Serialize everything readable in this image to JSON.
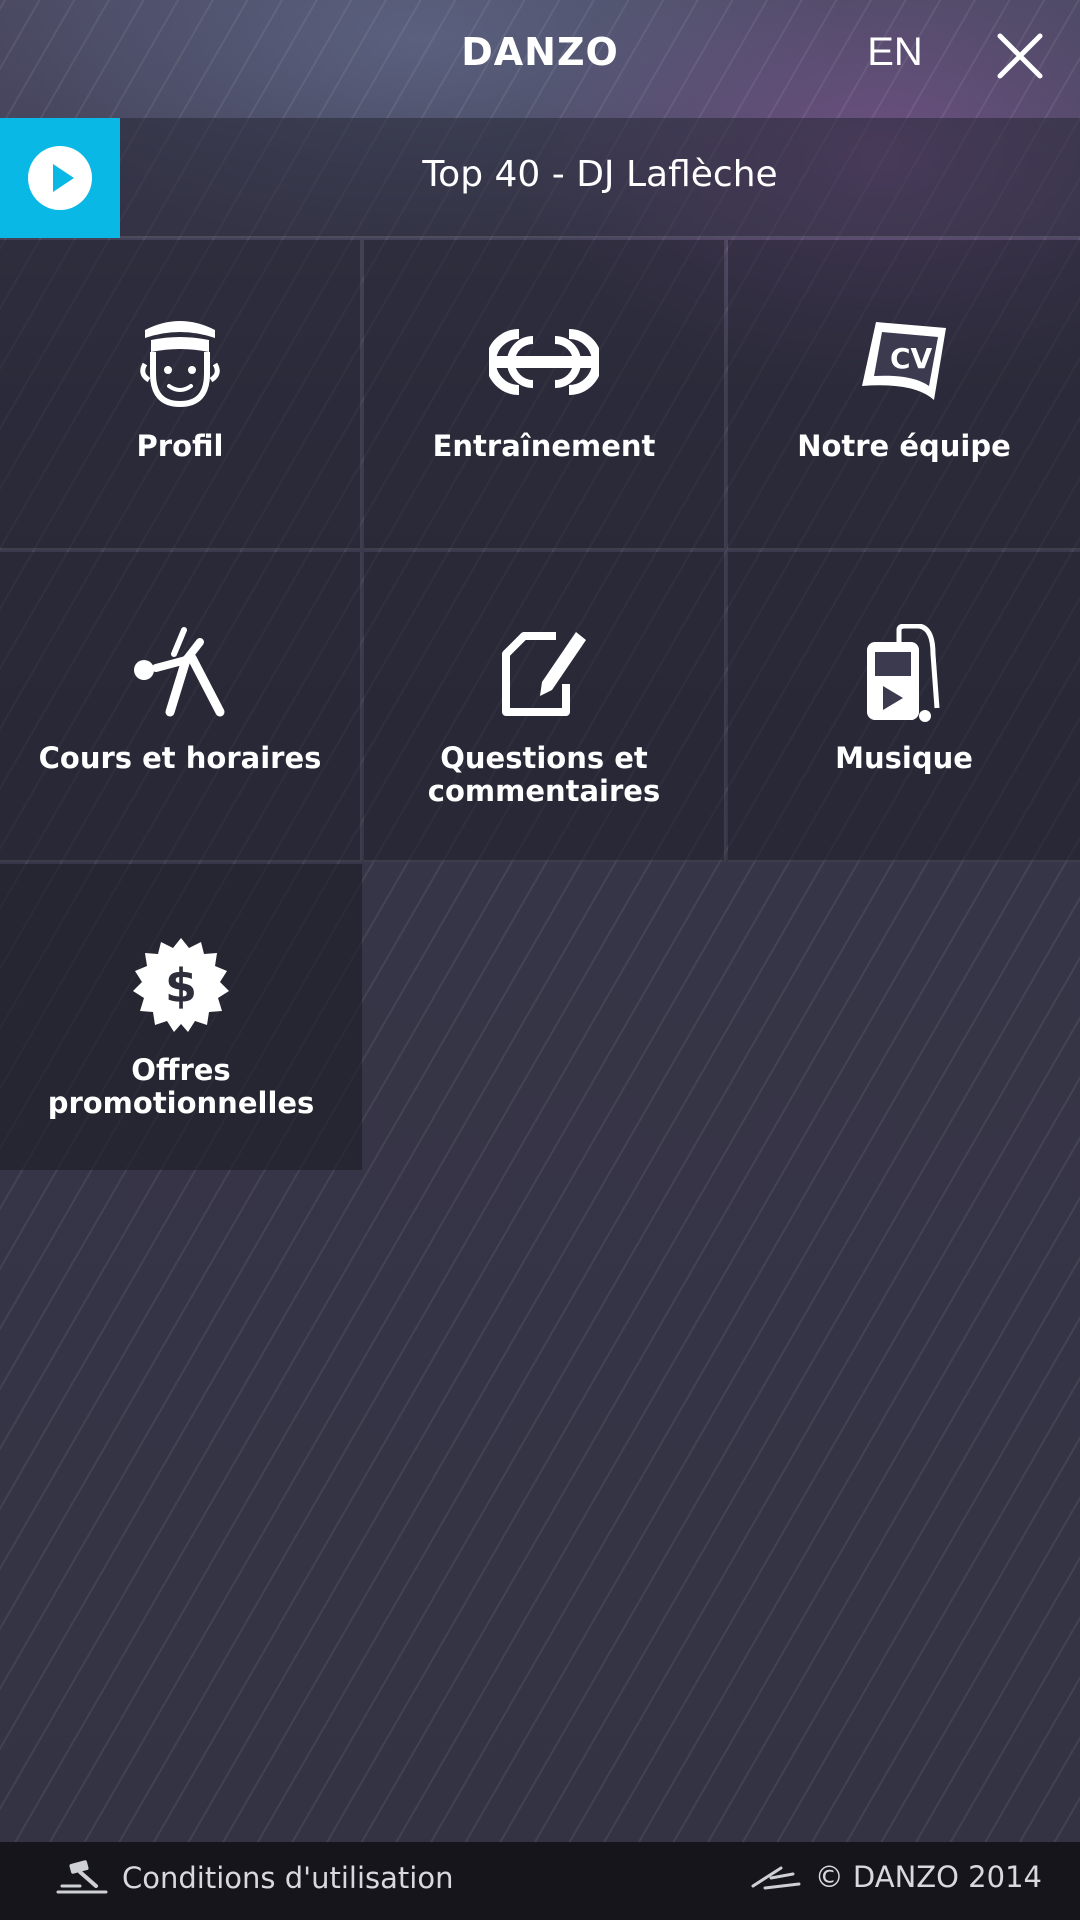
{
  "header": {
    "brand": "DANZO",
    "language": "EN",
    "close_icon": "close-icon"
  },
  "player": {
    "play_icon": "play-icon",
    "track": "Top 40 - DJ Laflèche",
    "accent_color": "#0AB8E6"
  },
  "tiles": [
    {
      "label": "Profil",
      "icon": "dancer-face-icon"
    },
    {
      "label": "Entraînement",
      "icon": "dumbbell-icon"
    },
    {
      "label": "Notre équipe",
      "icon": "cv-document-icon"
    },
    {
      "label": "Cours et horaires",
      "icon": "stretching-person-icon"
    },
    {
      "label": "Questions et commentaires",
      "icon": "edit-note-icon"
    },
    {
      "label": "Musique",
      "icon": "music-player-icon"
    },
    {
      "label": "Offres promotionnelles",
      "icon": "dollar-badge-icon"
    }
  ],
  "footer": {
    "terms_icon": "gavel-icon",
    "terms_label": "Conditions d'utilisation",
    "copyright_icon": "danzo-logo-icon",
    "copyright": "© DANZO 2014"
  }
}
